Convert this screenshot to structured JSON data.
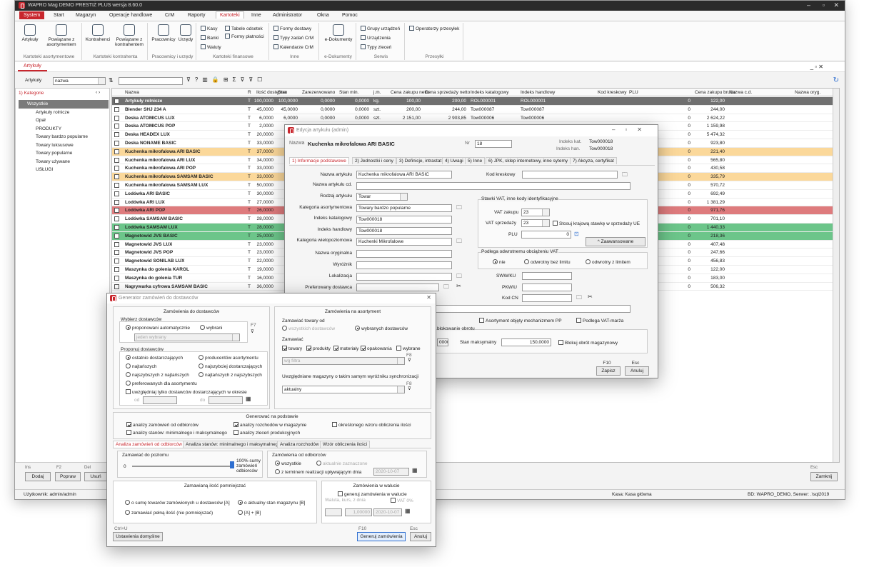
{
  "app": {
    "title": "WAPRO Mag DEMO PRESTIŻ PLUS  wersja 8.60.0"
  },
  "menu": [
    "System",
    "Start",
    "Magazyn",
    "Operacje handlowe",
    "CrM",
    "Raporty",
    "Kartoteki",
    "Inne",
    "Administrator",
    "Okna",
    "Pomoc"
  ],
  "ribbon": {
    "groups": [
      {
        "label": "Kartoteki asortymentowe",
        "buttons": [
          "Artykuły",
          "Powiązane z asortymentem"
        ]
      },
      {
        "label": "Kartoteki kontrahenta",
        "buttons": [
          "Kontrahenci",
          "Powiązane z kontrahentem"
        ]
      },
      {
        "label": "Pracownicy i urzędy",
        "buttons": [
          "Pracownicy",
          "Urzędy"
        ]
      },
      {
        "label": "Kartoteki finansowe",
        "small": [
          "Kasy",
          "Banki",
          "Waluty",
          "Tabele odsetek",
          "Formy płatności"
        ]
      },
      {
        "label": "Inne",
        "small": [
          "Formy dostawy",
          "Typy zadań CrM",
          "Kalendarze CrM"
        ]
      },
      {
        "label": "e-Dokumenty",
        "buttons": [
          "e-Dokumenty"
        ]
      },
      {
        "label": "Serwis",
        "small": [
          "Grupy urządzeń",
          "Urządzenia",
          "Typy zleceń"
        ]
      },
      {
        "label": "Przesyłki",
        "small": [
          "Operatorzy przesyłek"
        ]
      }
    ]
  },
  "doc_tab": "Artykuły",
  "toolbar": {
    "label": "Artykuły",
    "search_field": "nazwa"
  },
  "left": {
    "tab": "1) Kategorie",
    "tree": [
      "Wszystkie",
      "Artykuły rolnicze",
      "Opał",
      "PRODUKTY",
      "Towary bardzo popularne",
      "Towary luksusowe",
      "Towary popularne",
      "Towary używane",
      "USŁUGI"
    ],
    "buttons": [
      {
        "key": "Ins",
        "label": "Dodaj"
      },
      {
        "key": "F2",
        "label": "Popraw"
      },
      {
        "key": "Del",
        "label": "Usuń"
      }
    ]
  },
  "grid": {
    "columns": [
      "Nazwa",
      "R",
      "Ilość dostępna",
      "Stan",
      "Zarezerwowano",
      "Stan min.",
      "j.m.",
      "Cena zakupu netto",
      "Cena sprzedaży netto",
      "Indeks katalogowy",
      "Indeks handlowy",
      "Kod kreskowy",
      "PLU",
      "Cena zakupu brutto",
      "Nazwa c.d.",
      "Nazwa oryg."
    ],
    "rows": [
      {
        "name": "Artykuły rolnicze",
        "r": "T",
        "qty": "100,0000",
        "stan": "100,0000",
        "rez": "0,0000",
        "min": "0,0000",
        "jm": "kg.",
        "buy": "100,00",
        "sell": "200,00",
        "ik": "ROL000001",
        "ih": "ROL000001",
        "plu": "0",
        "gross": "122,00",
        "color": "selected"
      },
      {
        "name": "Blender SHJ 234 A",
        "r": "T",
        "qty": "45,0000",
        "stan": "45,0000",
        "rez": "0,0000",
        "min": "0,0000",
        "jm": "szt.",
        "buy": "200,00",
        "sell": "244,00",
        "ik": "Tow000087",
        "ih": "Tow000087",
        "plu": "0",
        "gross": "244,00",
        "color": ""
      },
      {
        "name": "Deska ATOMICUS LUX",
        "r": "T",
        "qty": "6,0000",
        "stan": "6,0000",
        "rez": "0,0000",
        "min": "0,0000",
        "jm": "szt.",
        "buy": "2 151,00",
        "sell": "2 903,85",
        "ik": "Tow000006",
        "ih": "Tow000006",
        "plu": "0",
        "gross": "2 624,22",
        "color": ""
      },
      {
        "name": "Deska ATOMICUS POP",
        "r": "T",
        "qty": "2,0000",
        "plu": "0",
        "gross": "1 159,98",
        "color": ""
      },
      {
        "name": "Deska HEADEX LUX",
        "r": "T",
        "qty": "20,0000",
        "plu": "0",
        "gross": "5 474,32",
        "color": ""
      },
      {
        "name": "Deska NONAME BASIC",
        "r": "T",
        "qty": "33,0000",
        "plu": "0",
        "gross": "923,80",
        "color": ""
      },
      {
        "name": "Kuchenka mikrofalowa ARI BASIC",
        "r": "T",
        "qty": "37,0000",
        "plu": "0",
        "gross": "221,40",
        "color": "orange"
      },
      {
        "name": "Kuchenka mikrofalowa ARI LUX",
        "r": "T",
        "qty": "34,0000",
        "plu": "0",
        "gross": "565,80",
        "color": ""
      },
      {
        "name": "Kuchenka mikrofalowa ARI POP",
        "r": "T",
        "qty": "33,0000",
        "plu": "0",
        "gross": "430,58",
        "color": ""
      },
      {
        "name": "Kuchenka mikrofalowa SAMSAM BASIC",
        "r": "T",
        "qty": "33,0000",
        "plu": "0",
        "gross": "335,79",
        "color": "orange"
      },
      {
        "name": "Kuchenka mikrofalowa SAMSAM LUX",
        "r": "T",
        "qty": "50,0000",
        "plu": "0",
        "gross": "570,72",
        "color": ""
      },
      {
        "name": "Lodówka ARI BASIC",
        "r": "T",
        "qty": "30,0000",
        "plu": "0",
        "gross": "692,49",
        "color": ""
      },
      {
        "name": "Lodówka ARI LUX",
        "r": "T",
        "qty": "27,0000",
        "plu": "0",
        "gross": "1 381,29",
        "color": ""
      },
      {
        "name": "Lodówka ARI POP",
        "r": "T",
        "qty": "26,0000",
        "plu": "0",
        "gross": "971,76",
        "color": "red"
      },
      {
        "name": "Lodówka SAMSAM BASIC",
        "r": "T",
        "qty": "28,0000",
        "plu": "0",
        "gross": "701,10",
        "color": ""
      },
      {
        "name": "Lodówka SAMSAM LUX",
        "r": "T",
        "qty": "28,0000",
        "plu": "0",
        "gross": "1 440,33",
        "color": "green"
      },
      {
        "name": "Magnetowid JVS BASIC",
        "r": "T",
        "qty": "25,0000",
        "plu": "0",
        "gross": "218,36",
        "color": "green"
      },
      {
        "name": "Magnetowid JVS LUX",
        "r": "T",
        "qty": "23,0000",
        "plu": "0",
        "gross": "407,48",
        "color": ""
      },
      {
        "name": "Magnetowid JVS POP",
        "r": "T",
        "qty": "23,0000",
        "plu": "0",
        "gross": "247,66",
        "color": ""
      },
      {
        "name": "Magnetowid SONILAB LUX",
        "r": "T",
        "qty": "22,0000",
        "plu": "0",
        "gross": "456,83",
        "color": ""
      },
      {
        "name": "Maszynka do golenia KAROL",
        "r": "T",
        "qty": "19,0000",
        "plu": "0",
        "gross": "122,00",
        "color": ""
      },
      {
        "name": "Maszynka do golenia TUR",
        "r": "T",
        "qty": "16,0000",
        "plu": "0",
        "gross": "183,00",
        "color": ""
      },
      {
        "name": "Nagrywarka cyfrowa SAMSAM BASIC",
        "r": "T",
        "qty": "36,0000",
        "plu": "0",
        "gross": "506,32",
        "color": ""
      }
    ],
    "close": {
      "key": "Esc",
      "label": "Zamknij"
    }
  },
  "status": {
    "user": "Użytkownik: admin/admin",
    "cash": "Kasa: Kasa główna",
    "db": "BD: WAPRO_DEMO, Serwer: .\\sql2019"
  },
  "edit": {
    "title": "Edycja artykułu (admin)",
    "name_label": "Nazwa",
    "name": "Kuchenka mikrofalowa ARI BASIC",
    "nr_label": "Nr",
    "nr": "18",
    "ik_label": "Indeks kat.",
    "ik": "Tow000018",
    "ih_label": "Indeks han.",
    "ih": "Tow000018",
    "tabs": [
      "1) Informacje podstawowe",
      "2) Jednostki i ceny",
      "3) Definicje, intrastat",
      "4) Uwagi",
      "5) Inne",
      "6) JPK, sklep internetowy, inne sytemy",
      "7) Akcyza, certyfikat"
    ],
    "f_name": "Nazwa artykułu",
    "v_name": "Kuchenka mikrofalowa ARI BASIC",
    "f_cd": "Nazwa artykułu cd.",
    "f_type": "Rodzaj artykułu",
    "v_type": "Towar",
    "f_cat": "Kategoria asortymentowa",
    "v_cat": "Towary bardzo popularne",
    "f_ik": "Indeks katalogowy",
    "v_ik": "Tow000018",
    "f_ih": "Indeks handlowy",
    "v_ih": "Tow000018",
    "f_multi": "Kategoria wielopoziomowa",
    "v_multi": "Kuchenki Mikrofalowe",
    "f_orig": "Nazwa oryginalna",
    "f_wyr": "Wyróżnik",
    "f_lok": "Lokalizacja",
    "f_dost": "Preferowany dostawca",
    "f_barcode": "Kod kreskowy",
    "vat_group": "Stawki VAT, inne kody identyfikacyjne",
    "f_vatz": "VAT zakupu",
    "v_vatz": "23",
    "f_vats": "VAT sprzedaży",
    "v_vats": "23",
    "vat_chk": "Stosuj krajową stawkę w sprzedaży UE",
    "f_plu": "PLU",
    "v_plu": "0",
    "adv": "Zaawansowane",
    "rev_group": "Podlega odwrotnemu obciążeniu VAT",
    "rev": [
      "nie",
      "odwrotny bez limitu",
      "odwrotny z limitem"
    ],
    "f_swwku": "SWW/KU",
    "f_pkwiu": "PKWiU",
    "f_cn": "Kod CN",
    "chk_mech": "Asortyment objęty mechanizmem PP",
    "chk_marza": "Podlega VAT-marża",
    "block": "blokowanie obrotu",
    "v_minstan": "0000",
    "f_maxstan": "Stan maksymalny",
    "v_maxstan": "150,0000",
    "chk_block": "Blokuj obrót magazynowy",
    "save_key": "F10",
    "save": "Zapisz",
    "cancel_key": "Esc",
    "cancel": "Anuluj"
  },
  "gen": {
    "title": "Generator zamówień do dostawców",
    "g1": "Zamówienia do dostawców",
    "choose": "Wybierz dostawców",
    "r_auto": "proponowani automatycznie",
    "r_sel": "wybrani",
    "sel_ph": "jeden wybrany",
    "k_f7": "F7",
    "propose": "Proponuj dostawców",
    "opts": [
      "ostatnio dostarczających",
      "producentów asortymentu",
      "najtańszych",
      "najszybciej dostarczających",
      "najszybszych z najtańszych",
      "najtańszych z najszybszych",
      "preferowanych dla asortymentu"
    ],
    "chk_period": "uwzględniaj tylko dostawców dostarczających w okresie",
    "od": "od",
    "do": "do",
    "g2": "Zamówienia na asortyment",
    "consider": "Zamawiać towary od",
    "r_all": "wszystkich dostawców",
    "r_chosen": "wybranych dostawców",
    "order": "Zamawiać",
    "types": [
      "towary",
      "produkty",
      "materiały",
      "opakowania",
      "wybrane"
    ],
    "k_f8": "F8",
    "type_ph": "wg filtra",
    "wh_label": "Uwzględniane magazyny o takim samym wyróżniku synchronizacji",
    "wh": "aktualny",
    "g3": "Generować na podstawie",
    "basis": [
      "analizy zamówień od odbiorców",
      "analizy rozchodów w magazynie",
      "określonego wzoru obliczenia ilości",
      "analizy stanów: minimalnego i maksymalnego",
      "analizy zleceń produkcyjnych"
    ],
    "tabs": [
      "Analiza zamówień od odbiorców",
      "Analiza stanów: minimalnego i maksymalnego",
      "Analiza rozchodów",
      "Wzór obliczenia ilości"
    ],
    "lvl": "Zamawiać do poziomu",
    "lvl0": "0",
    "lvl100": "100% sumy zamówień odbiorców",
    "g4": "Zamówienia od odbiorców",
    "o_all": "wszystkie",
    "o_cur": "aktualnie zaznaczone",
    "o_term": "z terminem realizacji upływającym dnia",
    "date1": "2020-10-07",
    "g5": "Zamawianą ilość pomniejszać",
    "q1": "o sumę towarów zamówionych u dostawców [A]",
    "q2": "o aktualny stan magazynu [B]",
    "q3": "zamawiać pełną ilość (nie pomniejszać)",
    "q4": "[A] + [B]",
    "g6": "Zamówienia w walucie",
    "cur_chk": "generuj zamówienia w walucie",
    "cur_l": "Waluta, kurs, z dnia",
    "vat0": "VAT 0%",
    "rate": "1,00000",
    "date2": "2020-10-07",
    "defaults_key": "Ctrl+U",
    "defaults": "Ustawienia domyślne",
    "gen_key": "F10",
    "gen_btn": "Generuj zamówienia",
    "cancel_key": "Esc",
    "cancel": "Anuluj"
  }
}
